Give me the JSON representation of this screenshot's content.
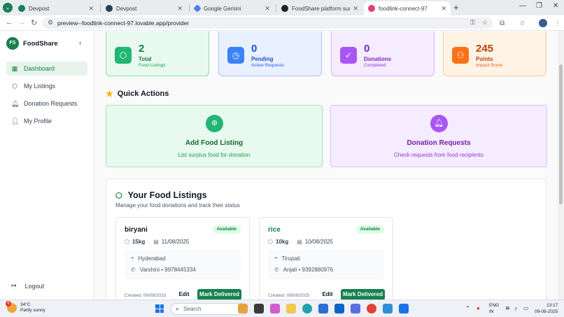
{
  "browser": {
    "tabs": [
      {
        "label": "Devpost",
        "favicon_color": "#1a7f5a"
      },
      {
        "label": "Devpost",
        "favicon_color": "#2b3f55"
      },
      {
        "label": "Google Gemini",
        "favicon_color": "#4a7df0"
      },
      {
        "label": "FoodShare platform summary",
        "favicon_color": "#202124"
      },
      {
        "label": "foodlink-connect-97",
        "favicon_color": "#e1426d"
      }
    ],
    "url": "preview--foodlink-connect-97.lovable.app/provider"
  },
  "sidebar": {
    "logo_text": "FS",
    "brand": "FoodShare",
    "items": [
      {
        "label": "Dashboard",
        "icon": "grid-icon",
        "active": true
      },
      {
        "label": "My Listings",
        "icon": "package-icon",
        "active": false
      },
      {
        "label": "Donation Requests",
        "icon": "bell-icon",
        "active": false
      },
      {
        "label": "My Profile",
        "icon": "user-icon",
        "active": false
      }
    ],
    "logout": "Logout"
  },
  "stats": [
    {
      "value": "2",
      "label": "Total",
      "sub": "Food Listings",
      "icon": "package-icon",
      "color": "#22b573"
    },
    {
      "value": "0",
      "label": "Pending",
      "sub": "Active Requests",
      "icon": "clock-icon",
      "color": "#3b82f6"
    },
    {
      "value": "0",
      "label": "Donations",
      "sub": "Completed",
      "icon": "check-circle-icon",
      "color": "#a855f7"
    },
    {
      "value": "245",
      "label": "Points",
      "sub": "Impact Score",
      "icon": "users-icon",
      "color": "#f97316"
    }
  ],
  "quick_actions": {
    "title": "Quick Actions",
    "cards": [
      {
        "title": "Add Food Listing",
        "sub": "List surplus food for donation",
        "icon": "plus-circle-icon"
      },
      {
        "title": "Donation Requests",
        "sub": "Check requests from food recipients",
        "icon": "bell-icon"
      }
    ]
  },
  "listings": {
    "title": "Your Food Listings",
    "subtitle": "Manage your food donations and track their status",
    "items": [
      {
        "name": "biryani",
        "status": "Available",
        "qty": "15kg",
        "date": "11/08/2025",
        "location": "Hyderabad",
        "contact": "Varshini • 9978445334",
        "created": "Created: 09/08/2025",
        "edit": "Edit",
        "action": "Mark Delivered"
      },
      {
        "name": "rice",
        "status": "Available",
        "qty": "10kg",
        "date": "10/08/2025",
        "location": "Tirupati",
        "contact": "Anjali • 9392880976",
        "created": "Created: 09/08/2025",
        "edit": "Edit",
        "action": "Mark Delivered"
      }
    ]
  },
  "taskbar": {
    "weather_badge": "6",
    "temp": "34°C",
    "condition": "Partly sunny",
    "search": "Search",
    "lang1": "ENG",
    "lang2": "IN",
    "time": "13:17",
    "date": "09-08-2025"
  }
}
